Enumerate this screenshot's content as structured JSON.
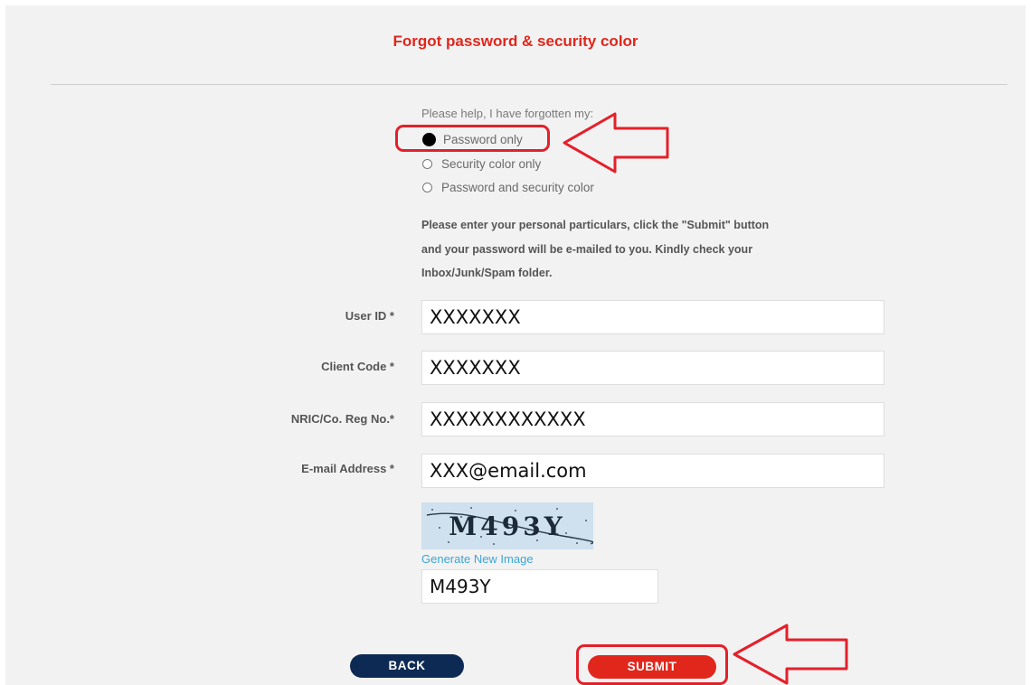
{
  "page": {
    "title": "Forgot password & security color"
  },
  "options": {
    "intro": "Please help, I have forgotten my:",
    "items": [
      {
        "label": "Password only",
        "selected": true
      },
      {
        "label": "Security color only",
        "selected": false
      },
      {
        "label": "Password and security color",
        "selected": false
      }
    ]
  },
  "instructions": {
    "line1": "Please enter your personal particulars, click the \"Submit\" button",
    "line2": "and your password will be e-mailed to you. Kindly check your",
    "line3": "Inbox/Junk/Spam folder."
  },
  "form": {
    "user_id": {
      "label": "User ID *",
      "value": "XXXXXXX"
    },
    "client_code": {
      "label": "Client Code *",
      "value": "XXXXXXX"
    },
    "nric": {
      "label": "NRIC/Co. Reg No.*",
      "value": "XXXXXXXXXXXX"
    },
    "email": {
      "label": "E-mail Address *",
      "value": "XXX@email.com"
    }
  },
  "captcha": {
    "image_text": "M493Y",
    "generate_link": "Generate New Image",
    "input_value": "M493Y"
  },
  "buttons": {
    "back": "BACK",
    "submit": "SUBMIT"
  },
  "colors": {
    "accent": "#e1261c",
    "navy": "#0d2a54",
    "annotation": "#e4202a"
  }
}
